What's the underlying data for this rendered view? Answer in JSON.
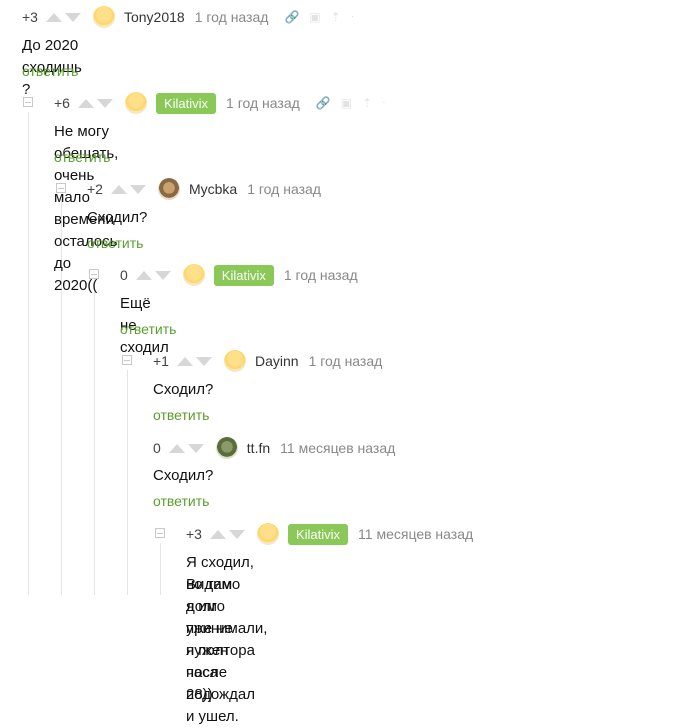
{
  "comments": [
    {
      "score": "+3",
      "author": "Tony2018",
      "time": "1 год назад",
      "text": "До 2020 сходишь ?",
      "reply": "ответить"
    },
    {
      "score": "+6",
      "author": "Kilativix",
      "time": "1 год назад",
      "text": "Не могу обещать, очень мало времени осталось до 2020((",
      "reply": "ответить"
    },
    {
      "score": "+2",
      "author": "Mycbka",
      "time": "1 год назад",
      "text": "Сходил?",
      "reply": "ответить"
    },
    {
      "score": "0",
      "author": "Kilativix",
      "time": "1 год назад",
      "text": "Ещё не сходил",
      "reply": "ответить"
    },
    {
      "score": "+1",
      "author": "Dayinn",
      "time": "1 год назад",
      "text": "Сходил?",
      "reply": "ответить"
    },
    {
      "score": "0",
      "author": "tt.fn",
      "time": "11 месяцев назад",
      "text": "Сходил?",
      "reply": "ответить"
    },
    {
      "score": "+3",
      "author": "Kilativix",
      "time": "11 месяцев назад",
      "text_line1": "Я сходил, но там долго принимали, я полтора часа подождал и ушел.",
      "text_line2": "Видимо я им уже не нужен после 28))"
    }
  ],
  "tool_icons": [
    "link-icon",
    "save-icon",
    "pin-icon",
    "more-icon"
  ],
  "colors": {
    "accent_green": "#8ac858",
    "reply_green": "#5a9e2d",
    "muted": "#888888"
  }
}
